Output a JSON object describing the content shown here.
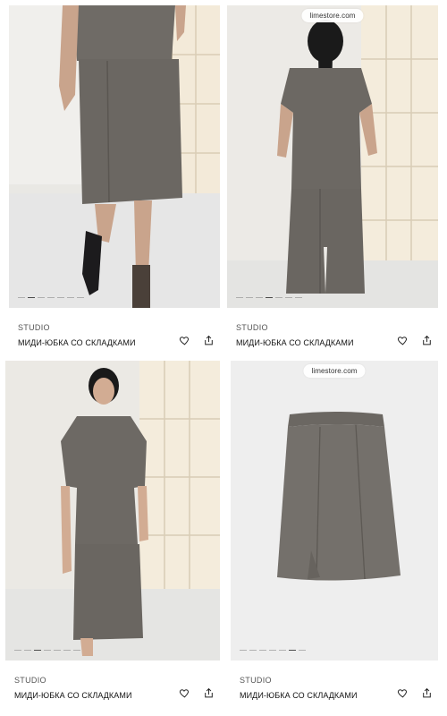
{
  "products": [
    {
      "brand": "STUDIO",
      "title": "МИДИ-ЮБКА СО СКЛАДКАМИ",
      "watermark": "",
      "images_count": 7,
      "active_image": 1
    },
    {
      "brand": "STUDIO",
      "title": "МИДИ-ЮБКА СО СКЛАДКАМИ",
      "watermark": "limestore.com",
      "images_count": 7,
      "active_image": 3
    },
    {
      "brand": "STUDIO",
      "title": "МИДИ-ЮБКА СО СКЛАДКАМИ",
      "watermark": "",
      "images_count": 7,
      "active_image": 2
    },
    {
      "brand": "STUDIO",
      "title": "МИДИ-ЮБКА СО СКЛАДКАМИ",
      "watermark": "limestore.com",
      "images_count": 7,
      "active_image": 5
    }
  ],
  "icons": {
    "favorite": "heart-icon",
    "share": "share-icon"
  },
  "colors": {
    "fabric": "#6e6a64",
    "background": "#ffffff",
    "text": "#111111"
  }
}
